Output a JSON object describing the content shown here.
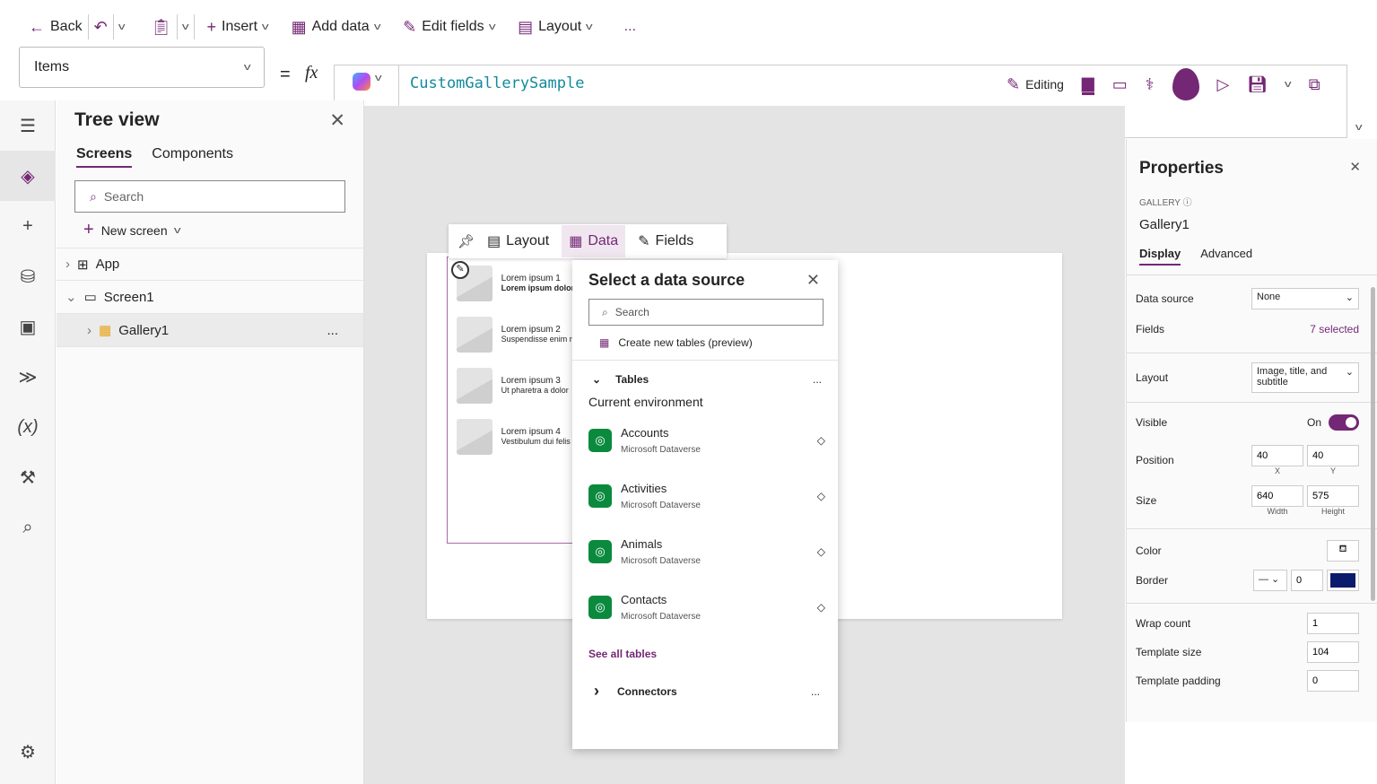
{
  "toolbar": {
    "back": "Back",
    "insert": "Insert",
    "add_data": "Add data",
    "edit_fields": "Edit fields",
    "layout": "Layout",
    "more": "...",
    "editing": "Editing"
  },
  "formula": {
    "property": "Items",
    "equals": "=",
    "fx": "fx",
    "value": "CustomGallerySample"
  },
  "tree": {
    "title": "Tree view",
    "tabs": [
      "Screens",
      "Components"
    ],
    "search_placeholder": "Search",
    "new_screen": "New screen",
    "items": [
      {
        "label": "App"
      },
      {
        "label": "Screen1"
      },
      {
        "label": "Gallery1"
      }
    ],
    "more": "..."
  },
  "gallery_toolbar": {
    "layout": "Layout",
    "data": "Data",
    "fields": "Fields"
  },
  "gallery_items": [
    {
      "title": "Lorem ipsum 1",
      "subtitle": "Lorem ipsum dolor"
    },
    {
      "title": "Lorem ipsum 2",
      "subtitle": "Suspendisse enim r"
    },
    {
      "title": "Lorem ipsum 3",
      "subtitle": "Ut pharetra a dolor"
    },
    {
      "title": "Lorem ipsum 4",
      "subtitle": "Vestibulum dui felis"
    }
  ],
  "datasource": {
    "title": "Select a data source",
    "search_placeholder": "Search",
    "create": "Create new tables (preview)",
    "tables": "Tables",
    "env": "Current environment",
    "items": [
      {
        "name": "Accounts",
        "source": "Microsoft Dataverse"
      },
      {
        "name": "Activities",
        "source": "Microsoft Dataverse"
      },
      {
        "name": "Animals",
        "source": "Microsoft Dataverse"
      },
      {
        "name": "Contacts",
        "source": "Microsoft Dataverse"
      }
    ],
    "see_all": "See all tables",
    "connectors": "Connectors",
    "more": "..."
  },
  "properties": {
    "title": "Properties",
    "type": "GALLERY",
    "name": "Gallery1",
    "tabs": [
      "Display",
      "Advanced"
    ],
    "data_source_label": "Data source",
    "data_source": "None",
    "fields_label": "Fields",
    "fields": "7 selected",
    "layout_label": "Layout",
    "layout": "Image, title, and subtitle",
    "visible_label": "Visible",
    "visible": "On",
    "position_label": "Position",
    "x": "40",
    "y": "40",
    "x_cap": "X",
    "y_cap": "Y",
    "size_label": "Size",
    "width": "640",
    "height": "575",
    "width_cap": "Width",
    "height_cap": "Height",
    "color_label": "Color",
    "border_label": "Border",
    "border_width": "0",
    "border_color": "#0b1a6b",
    "wrap_label": "Wrap count",
    "wrap": "1",
    "tsize_label": "Template size",
    "tsize": "104",
    "tpad_label": "Template padding",
    "tpad": "0"
  },
  "colors": {
    "accent": "#742774",
    "dataverse": "#0b8a3e"
  }
}
